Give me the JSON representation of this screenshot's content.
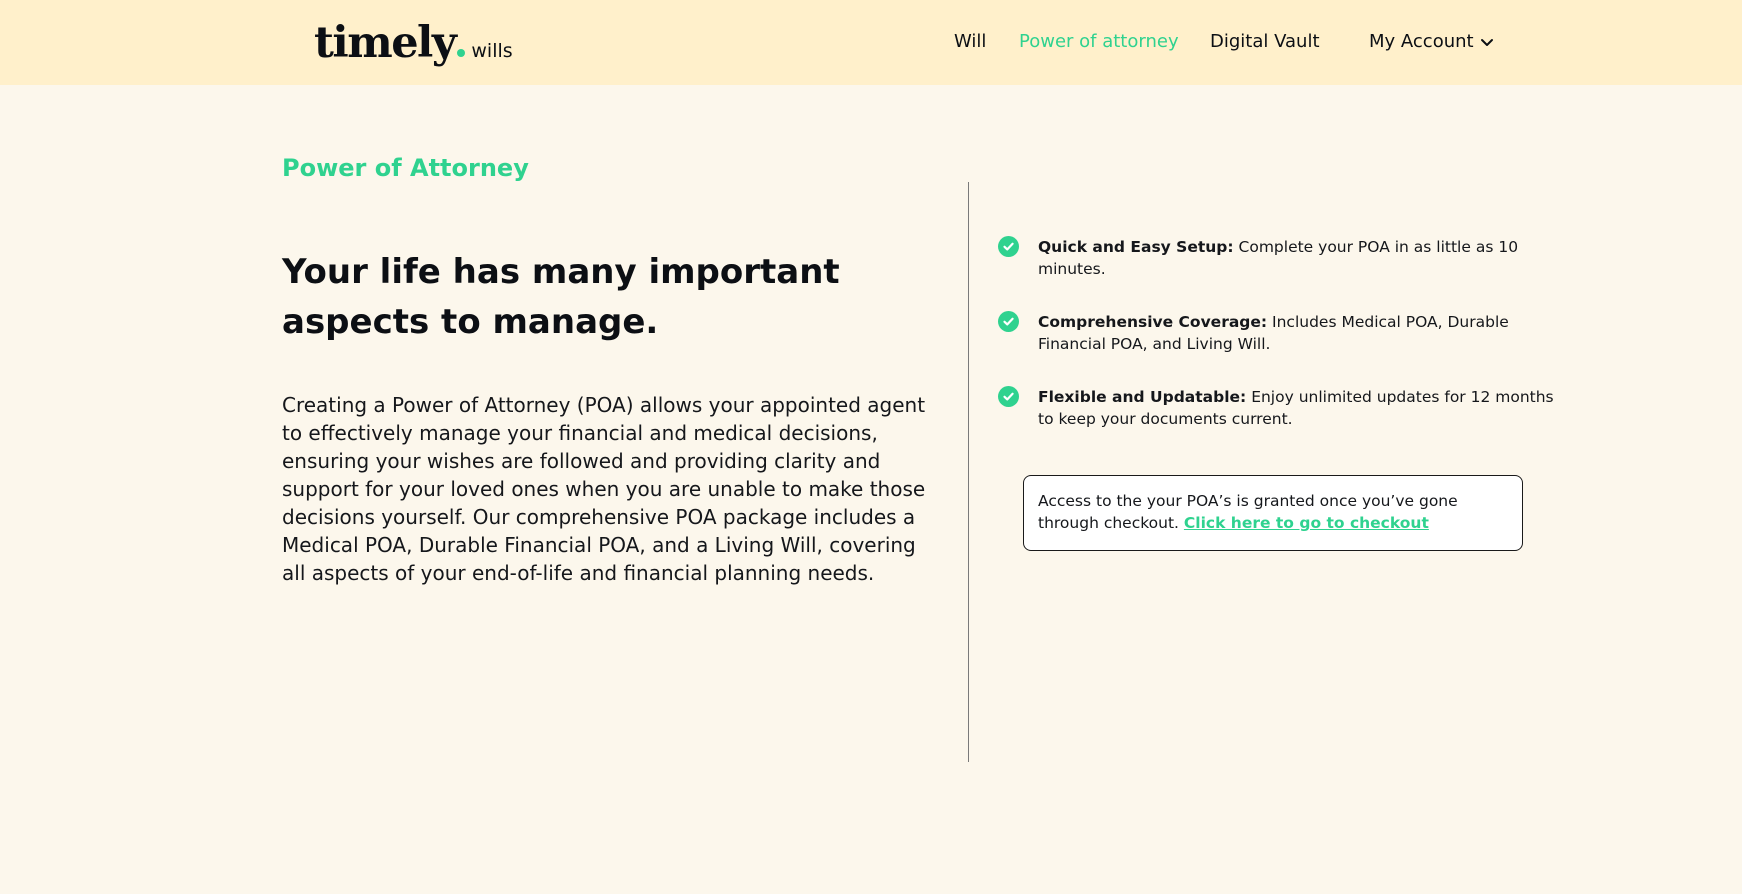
{
  "header": {
    "logo_word": "timely",
    "logo_sub": "wills",
    "nav": {
      "will": "Will",
      "poa": "Power of attorney",
      "vault": "Digital Vault",
      "account": "My Account"
    },
    "active_color": "#2fd28f"
  },
  "main": {
    "eyebrow": "Power of Attorney",
    "headline": "Your life has many important aspects to manage.",
    "body": "Creating a Power of Attorney (POA) allows your appointed agent to effectively manage your financial and medical decisions, ensuring your wishes are followed and providing clarity and support for your loved ones when you are unable to make those decisions yourself. Our comprehensive POA package includes a Medical POA, Durable Financial POA, and a Living Will, covering all aspects of your end-of-life and financial planning needs."
  },
  "features": [
    {
      "title": "Quick and Easy Setup:",
      "text": " Complete your POA in as little as 10 minutes."
    },
    {
      "title": "Comprehensive Coverage:",
      "text": " Includes Medical POA, Durable Financial POA, and Living Will."
    },
    {
      "title": "Flexible and Updatable:",
      "text": " Enjoy unlimited updates for 12 months to keep your documents current."
    }
  ],
  "notice": {
    "text": "Access to the your POA’s is granted once you’ve gone through checkout. ",
    "link": "Click here to go to checkout"
  },
  "colors": {
    "header_bg": "#fff0cb",
    "page_bg": "#fcf7ec",
    "accent": "#2fd28f"
  }
}
